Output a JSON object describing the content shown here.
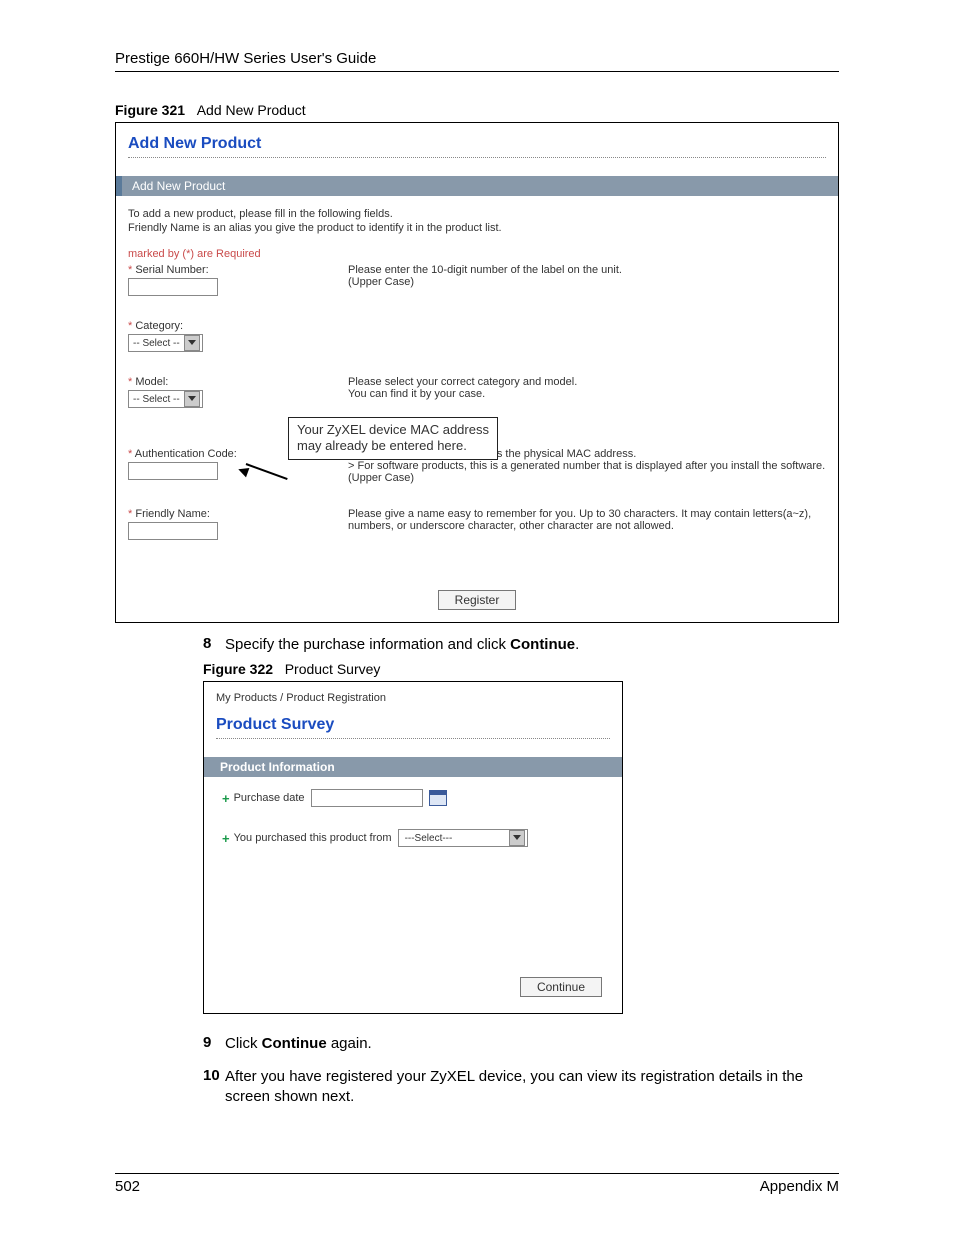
{
  "header": {
    "title": "Prestige 660H/HW Series User's Guide"
  },
  "figure321": {
    "caption_label": "Figure 321",
    "caption_text": "Add New Product",
    "title": "Add New Product",
    "section_bar": "Add New Product",
    "intro1": "To add a new product, please fill in the following fields.",
    "intro2": "Friendly Name is an alias you give the product to identify it in the product list.",
    "required_note": "marked by (*) are Required",
    "serial": {
      "label": "Serial Number:",
      "hint1": "Please enter the 10-digit number of the label on the unit.",
      "hint2": "(Upper Case)"
    },
    "category": {
      "label": "Category:",
      "select": "-- Select --"
    },
    "model": {
      "label": "Model:",
      "select": "-- Select --",
      "hint1": "Please select your correct category and model.",
      "hint2": "You can find it by your case."
    },
    "callout": {
      "line1": "Your ZyXEL device MAC address",
      "line2": "may already be entered here."
    },
    "auth": {
      "label": "Authentication Code:",
      "hint1": "> For hardware products, this is the physical MAC address.",
      "hint2": "> For software products, this is a generated number that is displayed after you install the software.",
      "hint3": "(Upper Case)"
    },
    "friendly": {
      "label": "Friendly Name:",
      "hint1": "Please give a name easy to remember for you. Up to 30 characters. It may contain letters(a~z), numbers, or underscore character, other character are not allowed."
    },
    "register_btn": "Register"
  },
  "step8": {
    "num": "8",
    "pre": "Specify the purchase information and click ",
    "bold": "Continue",
    "post": "."
  },
  "figure322": {
    "caption_label": "Figure 322",
    "caption_text": "Product Survey",
    "breadcrumb": "My Products / Product Registration",
    "title": "Product Survey",
    "section_bar": "Product Information",
    "purchase_date_label": "Purchase date",
    "purchased_from_label": "You purchased this product from",
    "purchased_from_select": "---Select---",
    "continue_btn": "Continue"
  },
  "step9": {
    "num": "9",
    "pre": "Click ",
    "bold": "Continue",
    "post": " again."
  },
  "step10": {
    "num": "10",
    "text": "After you have registered your ZyXEL device, you can view its registration details in the screen shown next."
  },
  "footer": {
    "page": "502",
    "section": "Appendix M"
  }
}
